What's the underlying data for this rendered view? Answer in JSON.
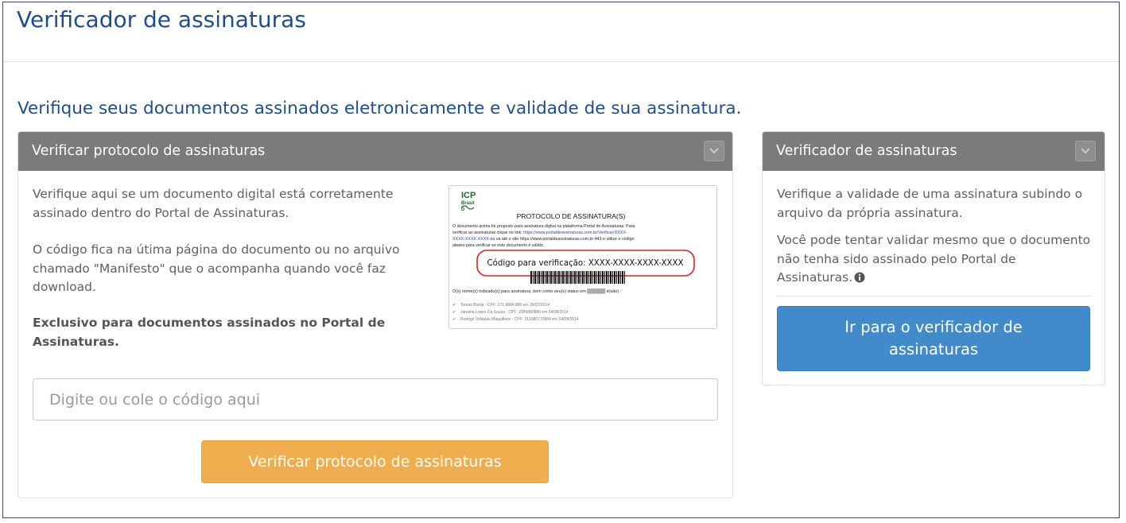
{
  "app": {
    "title": "Verificador de assinaturas"
  },
  "intro": "Verifique seus documentos assinados eletronicamente e validade de sua assinatura.",
  "left_panel": {
    "title": "Verificar protocolo de assinaturas",
    "collapse_icon": "chevron-down-icon",
    "p1": "Verifique aqui se um documento digital está corretamente assinado dentro do Portal de Assinaturas.",
    "p2": "O código fica na útima página do documento ou no arquivo chamado \"Manifesto\" que o acompanha quando você faz download.",
    "p3": "Exclusivo para documentos assinados no Portal de Assinaturas.",
    "example": {
      "logo_text_1": "ICP",
      "logo_text_2": "Brasil",
      "heading": "PROTOCOLO DE ASSINATURA(S)",
      "body_line_1": "O documento acima foi proposto para assinatura digital na plataforma Portal de Assinaturas. Para",
      "body_line_2_prefix": "verificar as assinaturas clique no link: ",
      "body_link_1": "https://www.portaldeassinaturas.com.br/Verificar/XXXX-",
      "body_link_2": "XXXX-XXXX-XXXX",
      "body_line_3_suffix": " ou vá até o site https://www.portaldeassinaturas.com.br:443 e utilize o código",
      "body_line_4": "abaixo para verificar se este documento é válido.",
      "code_label": "Código para verificação: XXXX-XXXX-XXXX-XXXX",
      "signers_line": "O(s) nome(s) indicado(s) para assinatura, bem como seu(s) status em",
      "signers_line_end": "é(são) :",
      "signer_1": "Tomas Borda - CPF: 271.9884.880 em 28/07/2014",
      "signer_2": "Janaina Lopes Da Souza - CPF: 2995880880 em 04/08/2014",
      "signer_3": "Rodrigo Valladas Maquiflexo - CPF: 212080770884 em 04/08/2014"
    },
    "input_placeholder": "Digite ou cole o código aqui",
    "input_value": "",
    "submit_label": "Verificar protocolo de assinaturas"
  },
  "right_panel": {
    "title": "Verificador de assinaturas",
    "collapse_icon": "chevron-down-icon",
    "p1": "Verifique a validade de uma assinatura subindo o arquivo da própria assinatura.",
    "p2": "Você pode tentar validar mesmo que o documento não tenha sido assinado pelo Portal de Assinaturas.",
    "info_icon": "info-circle-icon",
    "button_label": "Ir para o verificador de assinaturas"
  },
  "colors": {
    "title_blue": "#1f4e8c",
    "panel_header": "#7b7b7b",
    "button_orange": "#f0ad4e",
    "button_blue": "#428bca",
    "highlight_red": "#e02020"
  }
}
